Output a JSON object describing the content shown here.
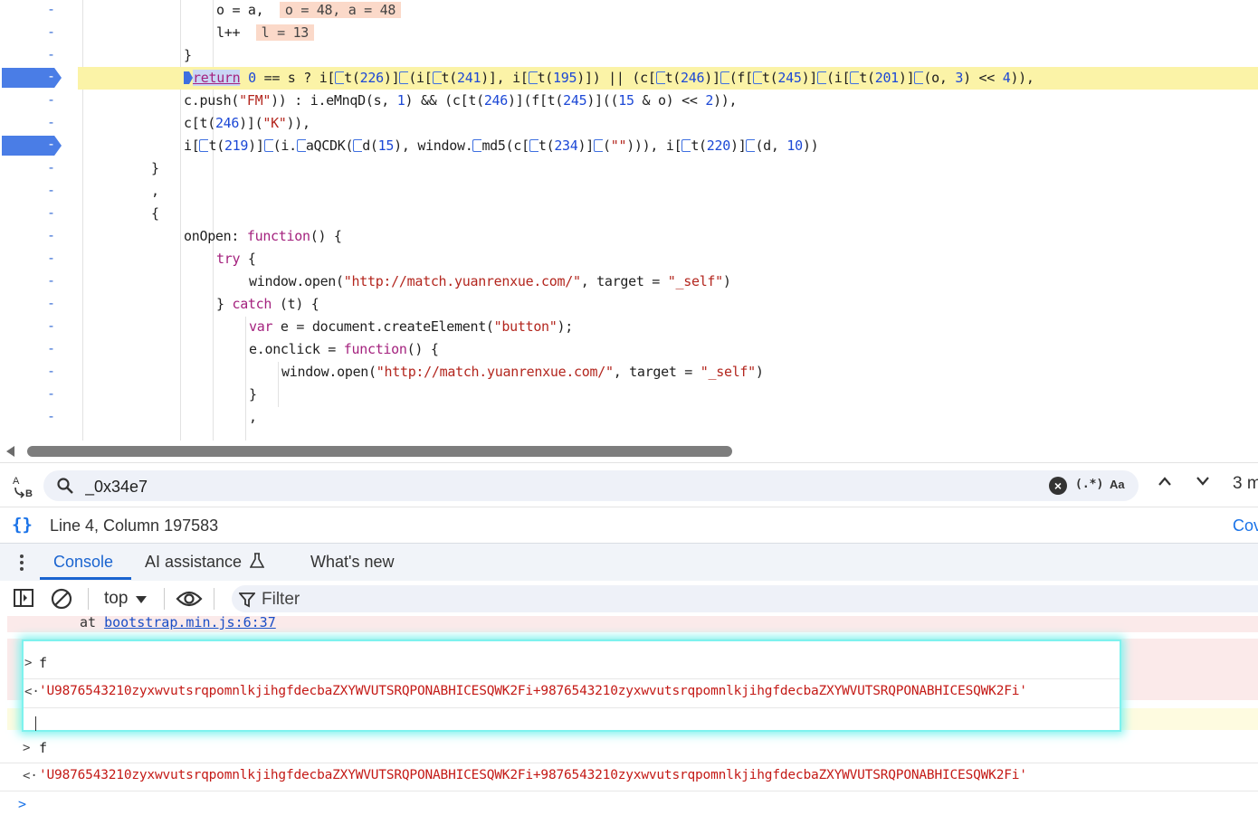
{
  "editor": {
    "lines": [
      {
        "indent": 5,
        "text": "o = a,  ",
        "inline": "o = 48, a = 48",
        "type": "inline"
      },
      {
        "indent": 5,
        "text": "l++  ",
        "inline": "l = 13",
        "type": "inline"
      },
      {
        "indent": 4,
        "text": "}",
        "type": "plain"
      },
      {
        "indent": 4,
        "text": "return 0 == s ? i[t(226)](i[t(241)], i[t(195)]) || (c[t(246)](f[t(245)](i[t(201)](o, 3) << 4)),",
        "type": "active"
      },
      {
        "indent": 4,
        "text": "c.push(\"FM\")) : i.eMnqD(s, 1) && (c[t(246)](f[t(245)]((15 & o) << 2)),",
        "type": "plain"
      },
      {
        "indent": 4,
        "text": "c[t(246)](\"K\")),",
        "type": "plain"
      },
      {
        "indent": 4,
        "text": "i[t(219)](i.aQCDK(d(15), window.md5(c[t(234)](\"\"))), i[t(220)](d, 10))",
        "type": "bp"
      },
      {
        "indent": 3,
        "text": "}",
        "type": "plain"
      },
      {
        "indent": 3,
        "text": ",",
        "type": "plain"
      },
      {
        "indent": 3,
        "text": "{",
        "type": "plain"
      },
      {
        "indent": 4,
        "text": "onOpen: function() {",
        "type": "plain"
      },
      {
        "indent": 5,
        "text": "try {",
        "type": "plain"
      },
      {
        "indent": 6,
        "text": "window.open(\"http://match.yuanrenxue.com/\", target = \"_self\")",
        "type": "plain"
      },
      {
        "indent": 5,
        "text": "} catch (t) {",
        "type": "plain"
      },
      {
        "indent": 6,
        "text": "var e = document.createElement(\"button\");",
        "type": "plain"
      },
      {
        "indent": 6,
        "text": "e.onclick = function() {",
        "type": "plain"
      },
      {
        "indent": 7,
        "text": "window.open(\"http://match.yuanrenxue.com/\", target = \"_self\")",
        "type": "plain"
      },
      {
        "indent": 6,
        "text": "}",
        "type": "plain"
      },
      {
        "indent": 6,
        "text": ",",
        "type": "plain"
      }
    ],
    "gutter_mark": "-"
  },
  "search": {
    "icon": "search-icon",
    "value": "_0x34e7",
    "regex_label": "(.*)",
    "case_label": "Aa",
    "match_count": "3 m"
  },
  "status": {
    "position": "Line 4, Column 197583",
    "coverage": "Cov"
  },
  "drawer": {
    "tabs": [
      {
        "label": "Console",
        "active": true
      },
      {
        "label": "AI assistance",
        "active": false
      },
      {
        "label": "What's new",
        "active": false
      }
    ]
  },
  "console_toolbar": {
    "context": "top",
    "filter_placeholder": "Filter"
  },
  "console": {
    "at_prefix": "at ",
    "at_link": "bootstrap.min.js:6:37",
    "entries": [
      {
        "kind": "input",
        "text": "f"
      },
      {
        "kind": "result",
        "text": "'U9876543210zyxwvutsrqpomnlkjihgfdecbaZXYWVUTSRQPONABHICESQWK2Fi+9876543210zyxwvutsrqpomnlkjihgfdecbaZXYWVUTSRQPONABHICESQWK2Fi'"
      }
    ]
  },
  "popup": {
    "input": "f",
    "result": "'U9876543210zyxwvutsrqpomnlkjihgfdecbaZXYWVUTSRQPONABHICESQWK2Fi+9876543210zyxwvutsrqpomnlkjihgfdecbaZXYWVUTSRQPONABHICESQWK2Fi'"
  },
  "colors": {
    "accent": "#1a64d0",
    "breakpoint": "#4a7de6",
    "highlight_line": "#fbf3a7",
    "error_bg": "#fbeaea",
    "result_red": "#c41a16",
    "popup_glow": "#7ef2ee"
  }
}
